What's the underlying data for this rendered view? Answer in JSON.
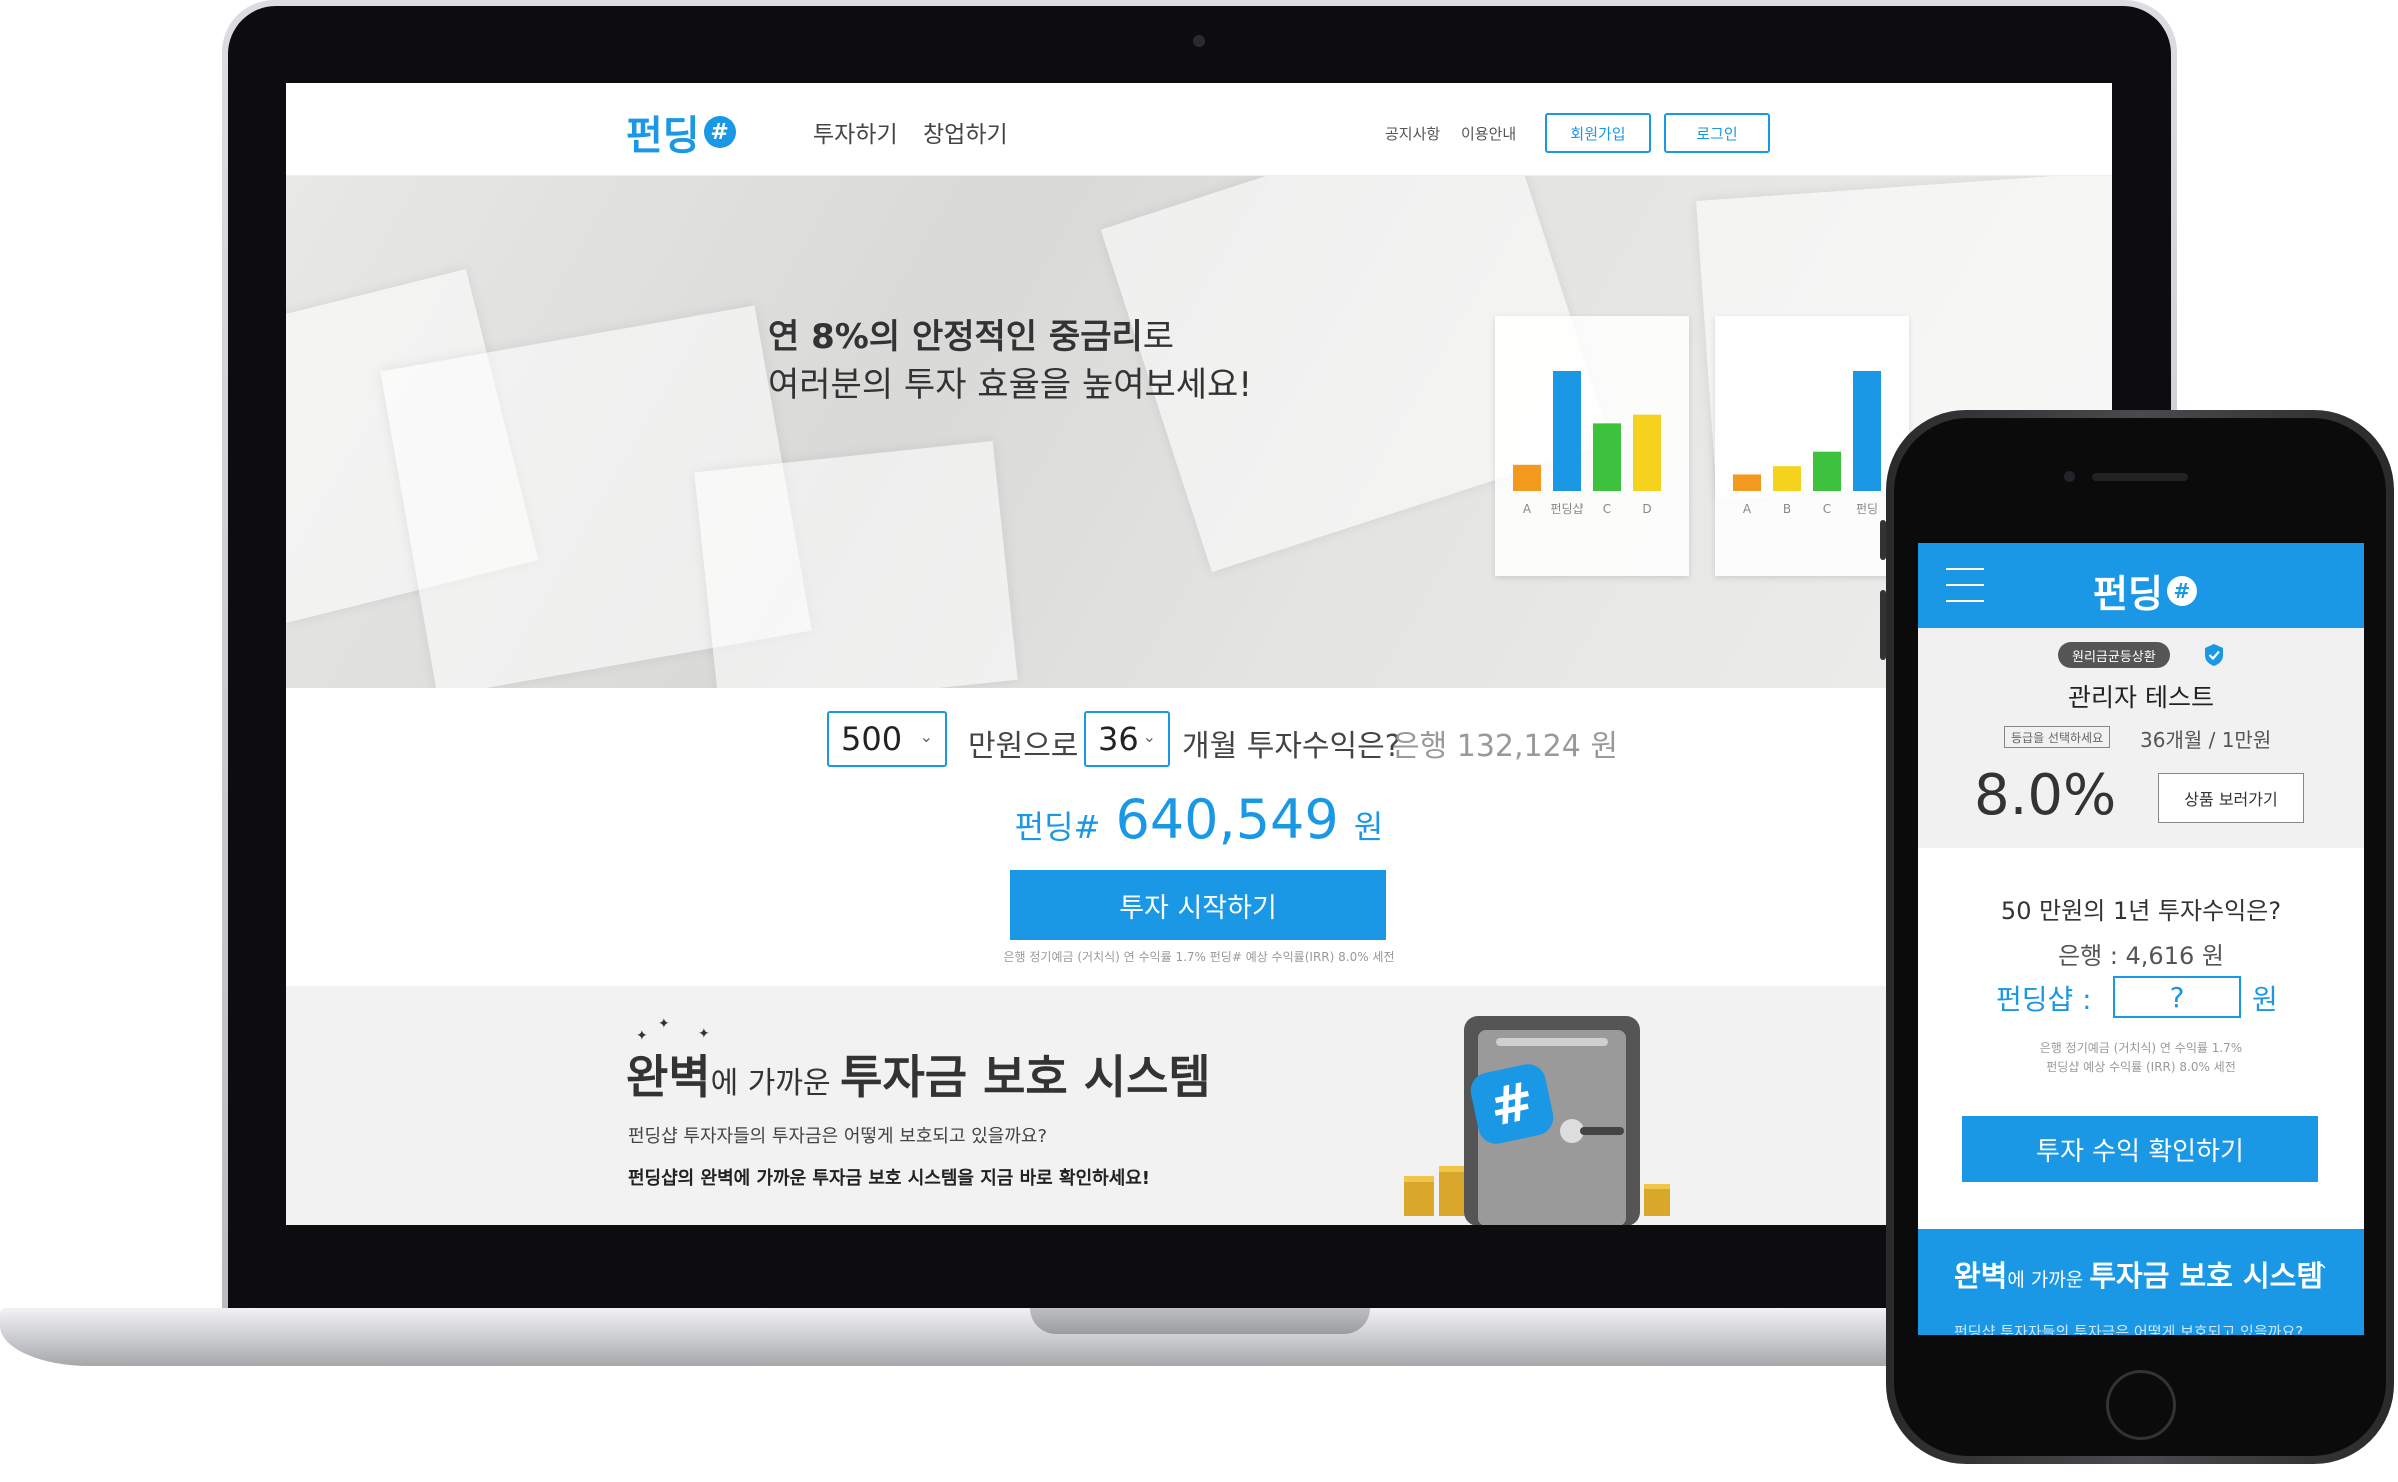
{
  "brand": {
    "logo_text": "펀딩",
    "logo_mark": "#",
    "accent": "#1a97e5"
  },
  "desktop": {
    "nav": [
      "투자하기",
      "창업하기"
    ],
    "util_links": [
      "공지사항",
      "이용안내"
    ],
    "signup_label": "회원가입",
    "login_label": "로그인",
    "hero": {
      "line1_bold": "연 8%의 안정적인 중금리",
      "line1_tail": "로",
      "line2": "여러분의 투자 효율을 높여보세요!"
    },
    "charts": [
      {
        "labels": [
          "A",
          "펀딩샵",
          "C",
          "D"
        ],
        "values": [
          1.2,
          5.5,
          3.1,
          3.5
        ],
        "colors": [
          "#f39a1e",
          "#1a97e5",
          "#3cc23c",
          "#f5d21e"
        ]
      },
      {
        "labels": [
          "A",
          "B",
          "C",
          "펀딩"
        ],
        "values": [
          0.8,
          1.2,
          1.9,
          5.8
        ],
        "colors": [
          "#f39a1e",
          "#f5d21e",
          "#3cc23c",
          "#1a97e5"
        ]
      }
    ],
    "calculator": {
      "amount": "500",
      "amount_suffix": "만원으로",
      "months": "36",
      "months_suffix": "개월 투자수익은?",
      "bank_text": "은행 132,124 원",
      "result_prefix": "펀딩#",
      "result_value": "640,549",
      "result_unit": "원",
      "start_label": "투자 시작하기",
      "disclaimer": "은행 정기예금 (거치식) 연 수익률 1.7% 펀딩# 예상 수익률(IRR) 8.0% 세전"
    },
    "protect": {
      "title_a": "완벽",
      "title_b": "에 가까운 ",
      "title_c": "투자금 보호 시스템",
      "sub1": "펀딩샵 투자자들의 투자금은 어떻게 보호되고 있을까요?",
      "sub2": "펀딩샵의 완벽에 가까운 투자금 보호 시스템을 지금 바로 확인하세요!"
    }
  },
  "mobile": {
    "tag": "원리금균등상환",
    "product_name": "관리자 테스트",
    "grade_label": "등급을 선택하세요",
    "terms": "36개월 / 1만원",
    "rate": "8.0%",
    "detail_label": "상품 보러가기",
    "question": "50 만원의 1년 투자수익은?",
    "bank_text": "은행 : 4,616 원",
    "fund_label": "펀딩샵 :",
    "fund_value": "?",
    "fund_unit": "원",
    "disclaimer_1": "은행 정기예금 (거치식) 연 수익률 1.7%",
    "disclaimer_2": "펀딩샵 예상 수익률 (IRR) 8.0% 세전",
    "check_label": "투자 수익 확인하기",
    "protect_a": "완벽",
    "protect_b": "에 가까운 ",
    "protect_c": "투자금 보호 시스템",
    "protect_sub": "펀딩샵 투자자들의 투자금은 어떻게 보호되고 있을까요?"
  }
}
